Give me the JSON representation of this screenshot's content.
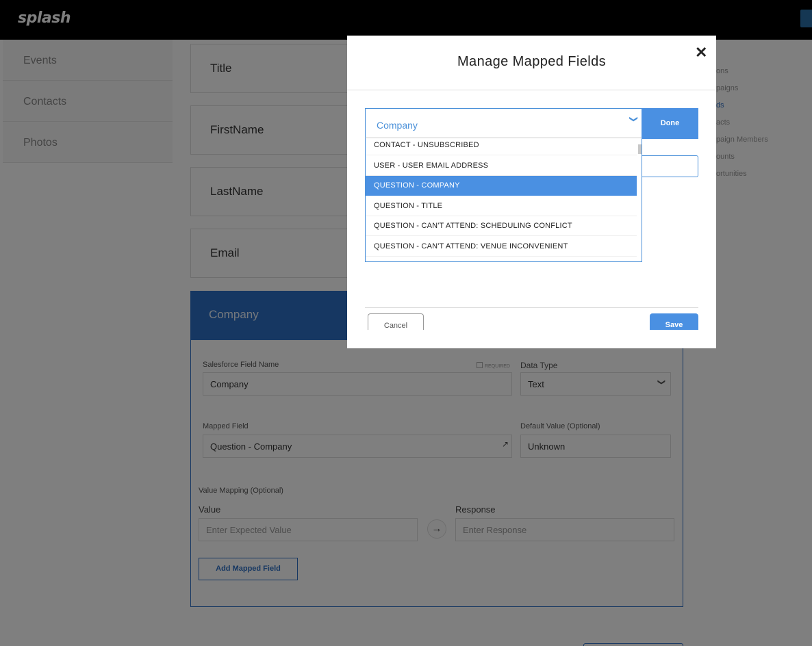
{
  "app": {
    "logo": "splash"
  },
  "left_nav": {
    "items": [
      {
        "label": "Events"
      },
      {
        "label": "Contacts"
      },
      {
        "label": "Photos"
      }
    ]
  },
  "fields": [
    {
      "label": "Title"
    },
    {
      "label": "FirstName"
    },
    {
      "label": "LastName"
    },
    {
      "label": "Email"
    }
  ],
  "company_card": {
    "title": "Company",
    "salesforce_field_label": "Salesforce Field Name",
    "required_label": "REQUIRED",
    "salesforce_field_value": "Company",
    "data_type_label": "Data Type",
    "data_type_value": "Text",
    "mapped_field_label": "Mapped Field",
    "mapped_field_value": "Question - Company",
    "default_value_label": "Default Value (Optional)",
    "default_value": "Unknown",
    "value_mapping_label": "Value Mapping (Optional)",
    "value_label": "Value",
    "value_placeholder": "Enter Expected Value",
    "response_label": "Response",
    "response_placeholder": "Enter Response",
    "add_button": "Add Mapped Field"
  },
  "right_nav": {
    "items": [
      {
        "label": "ons"
      },
      {
        "label": "paigns"
      },
      {
        "label": "ds"
      },
      {
        "label": "acts"
      },
      {
        "label": "paign Members"
      },
      {
        "label": "ounts"
      },
      {
        "label": "ortunities"
      }
    ]
  },
  "modal": {
    "title": "Manage Mapped Fields",
    "close_glyph": "✕",
    "select_value": "Company",
    "select_chevron": "❯",
    "done_label": "Done",
    "options": [
      {
        "label": "CONTACT - UNSUBSCRIBED",
        "active": false
      },
      {
        "label": "USER - USER EMAIL ADDRESS",
        "active": false
      },
      {
        "label": "QUESTION - COMPANY",
        "active": true
      },
      {
        "label": "QUESTION - TITLE",
        "active": false
      },
      {
        "label": "QUESTION - CAN'T ATTEND: SCHEDULING CONFLICT",
        "active": false
      },
      {
        "label": "QUESTION - CAN'T ATTEND: VENUE INCONVENIENT",
        "active": false
      }
    ],
    "cancel_label": "Cancel",
    "save_label": "Save"
  },
  "icons": {
    "arrow": "→",
    "external_link": "↗",
    "chevron_down": "❯"
  },
  "colors": {
    "accent": "#2d6fc4",
    "active_option": "#4a90e2",
    "topbar": "#000000"
  }
}
